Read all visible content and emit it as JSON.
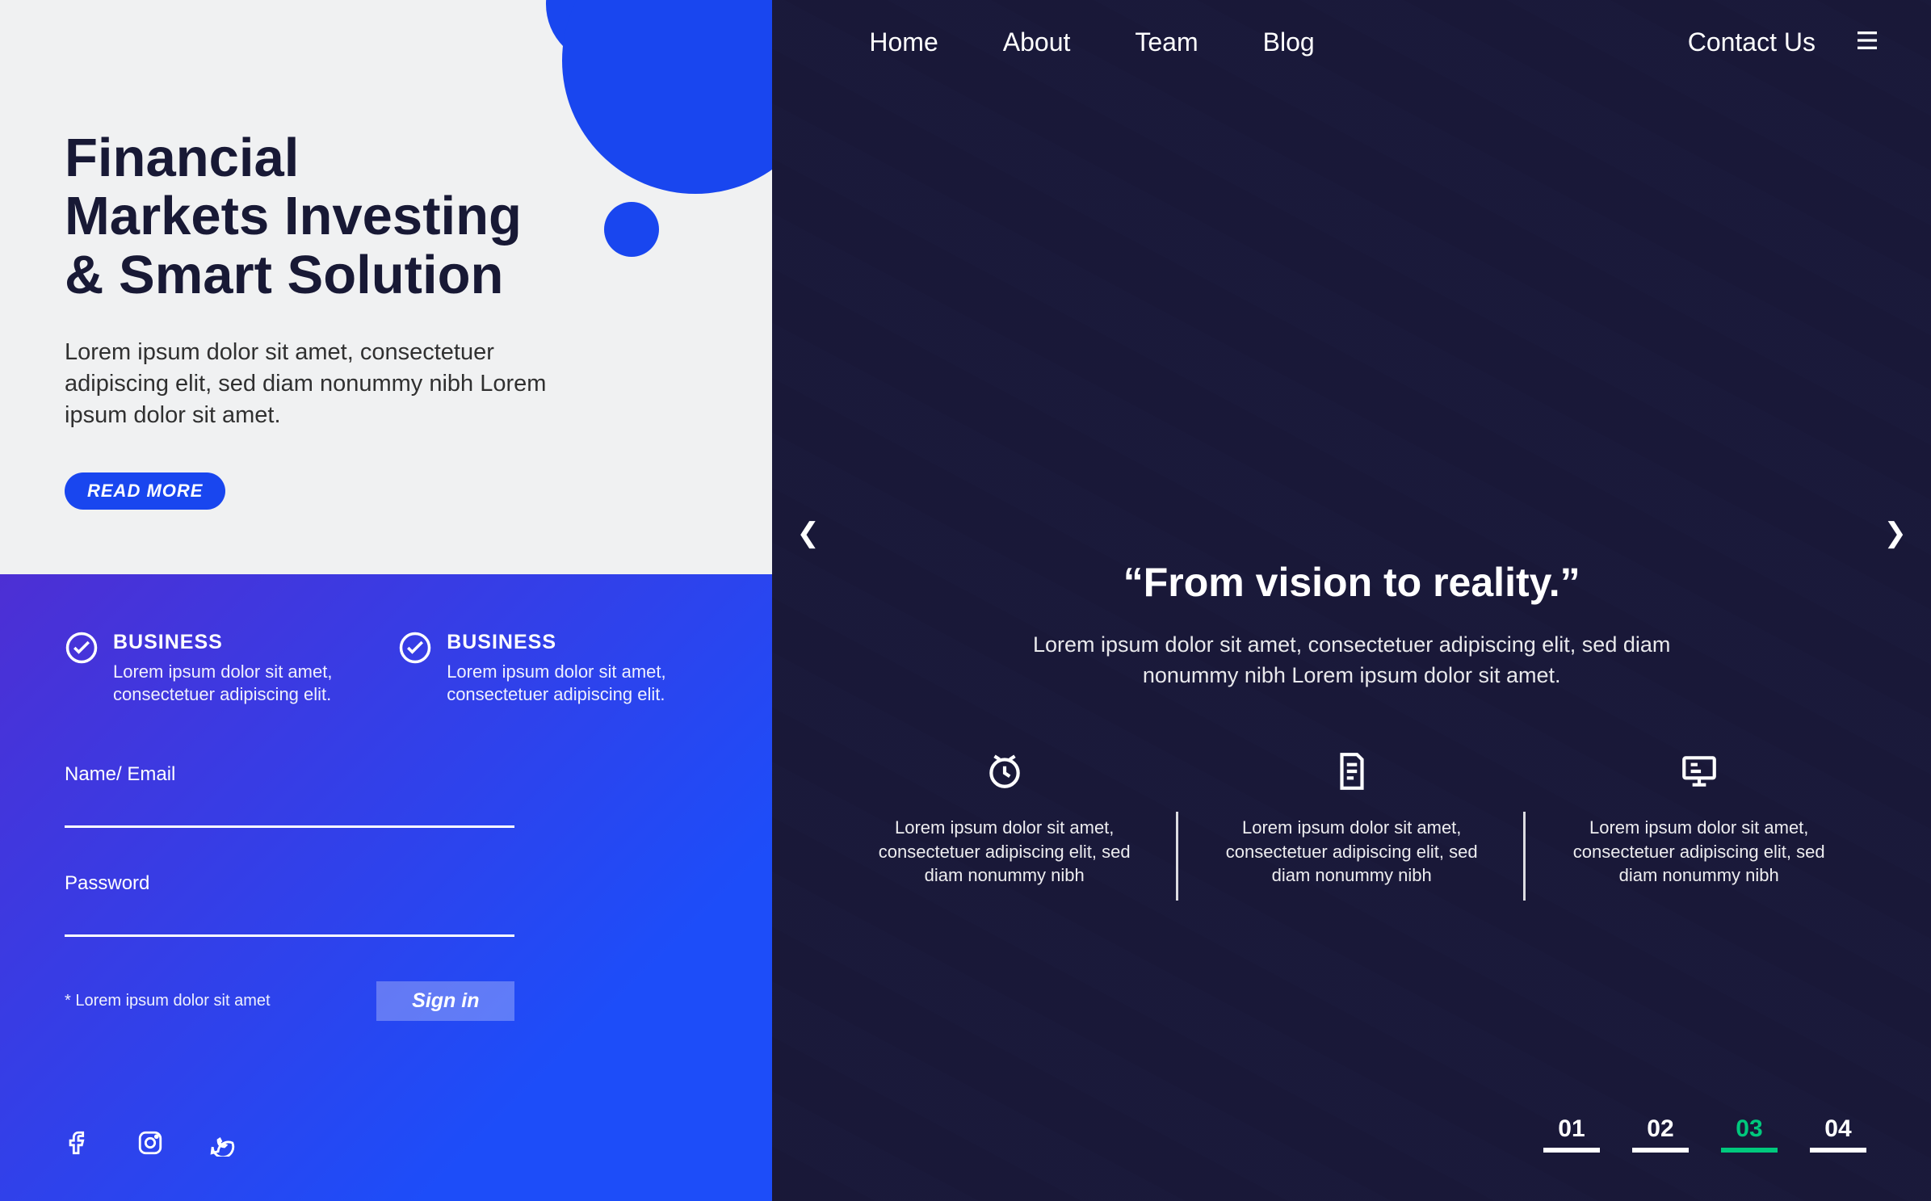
{
  "nav": {
    "items": [
      "Home",
      "About",
      "Team",
      "Blog"
    ],
    "contact": "Contact Us"
  },
  "hero": {
    "title_l1": "Financial",
    "title_l2": "Markets Investing",
    "title_l3": "& Smart Solution",
    "desc": "Lorem ipsum dolor sit amet, consectetuer adipiscing elit, sed diam nonummy nibh Lorem ipsum dolor sit amet.",
    "readmore": "READ MORE"
  },
  "business": [
    {
      "label": "BUSINESS",
      "desc": "Lorem ipsum dolor sit amet, consectetuer adipiscing elit."
    },
    {
      "label": "BUSINESS",
      "desc": "Lorem ipsum dolor sit amet, consectetuer adipiscing elit."
    }
  ],
  "form": {
    "name_label": "Name/ Email",
    "password_label": "Password",
    "note": "* Lorem ipsum dolor sit amet",
    "signin": "Sign in"
  },
  "socials": {
    "facebook": "facebook-icon",
    "instagram": "instagram-icon",
    "whatsapp": "whatsapp-icon"
  },
  "slider": {
    "quote": "“From vision to reality.”",
    "desc": "Lorem ipsum dolor sit amet, consectetuer adipiscing elit, sed diam nonummy nibh  Lorem ipsum dolor sit amet."
  },
  "features": [
    {
      "icon": "clock-icon",
      "text": "Lorem ipsum dolor sit amet, consectetuer adipiscing elit, sed diam nonummy nibh"
    },
    {
      "icon": "document-icon",
      "text": "Lorem ipsum dolor sit amet, consectetuer adipiscing elit, sed diam nonummy nibh"
    },
    {
      "icon": "monitor-icon",
      "text": "Lorem ipsum dolor sit amet, consectetuer adipiscing elit, sed diam nonummy nibh"
    }
  ],
  "pager": {
    "items": [
      "01",
      "02",
      "03",
      "04"
    ],
    "active_index": 2
  }
}
